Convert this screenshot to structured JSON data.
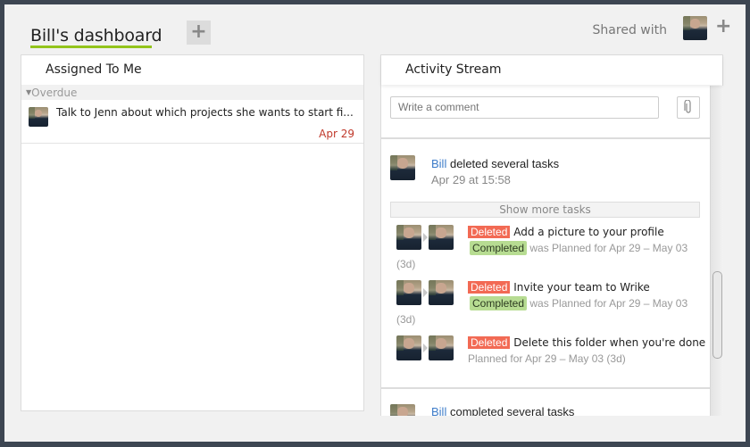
{
  "header": {
    "dashboard_title": "Bill's dashboard",
    "add_dashboard_icon": "plus-icon",
    "shared_with_label": "Shared with",
    "shared_add_icon": "plus-icon",
    "accent_color": "#93c41c"
  },
  "assigned": {
    "title": "Assigned To Me",
    "groups": [
      {
        "label": "Overdue",
        "tasks": [
          {
            "title": "Talk to Jenn about which projects she wants to start fi...",
            "date": "Apr 29"
          }
        ]
      }
    ]
  },
  "stream": {
    "title": "Activity Stream",
    "comment_placeholder": "Write a comment",
    "attach_icon": "paperclip-icon",
    "events": [
      {
        "user": "Bill",
        "action": "deleted several tasks",
        "time": "Apr 29 at 15:58",
        "show_more": "Show more tasks",
        "items": [
          {
            "status": "Deleted",
            "title": "Add a picture to your profile",
            "sub_status": "Completed",
            "detail": "was Planned for Apr 29 – May 03",
            "duration": "(3d)"
          },
          {
            "status": "Deleted",
            "title": "Invite your team to Wrike",
            "sub_status": "Completed",
            "detail": "was Planned for Apr 29 – May 03",
            "duration": "(3d)"
          },
          {
            "status": "Deleted",
            "title": "Delete this folder when you're done",
            "detail": "Planned for Apr 29 – May 03 (3d)"
          }
        ]
      },
      {
        "user": "Bill",
        "action": "completed several tasks"
      }
    ],
    "colors": {
      "deleted": "#f26a54",
      "completed": "#b7dc92",
      "link": "#3d7cc9",
      "overdue": "#c0392b"
    }
  }
}
